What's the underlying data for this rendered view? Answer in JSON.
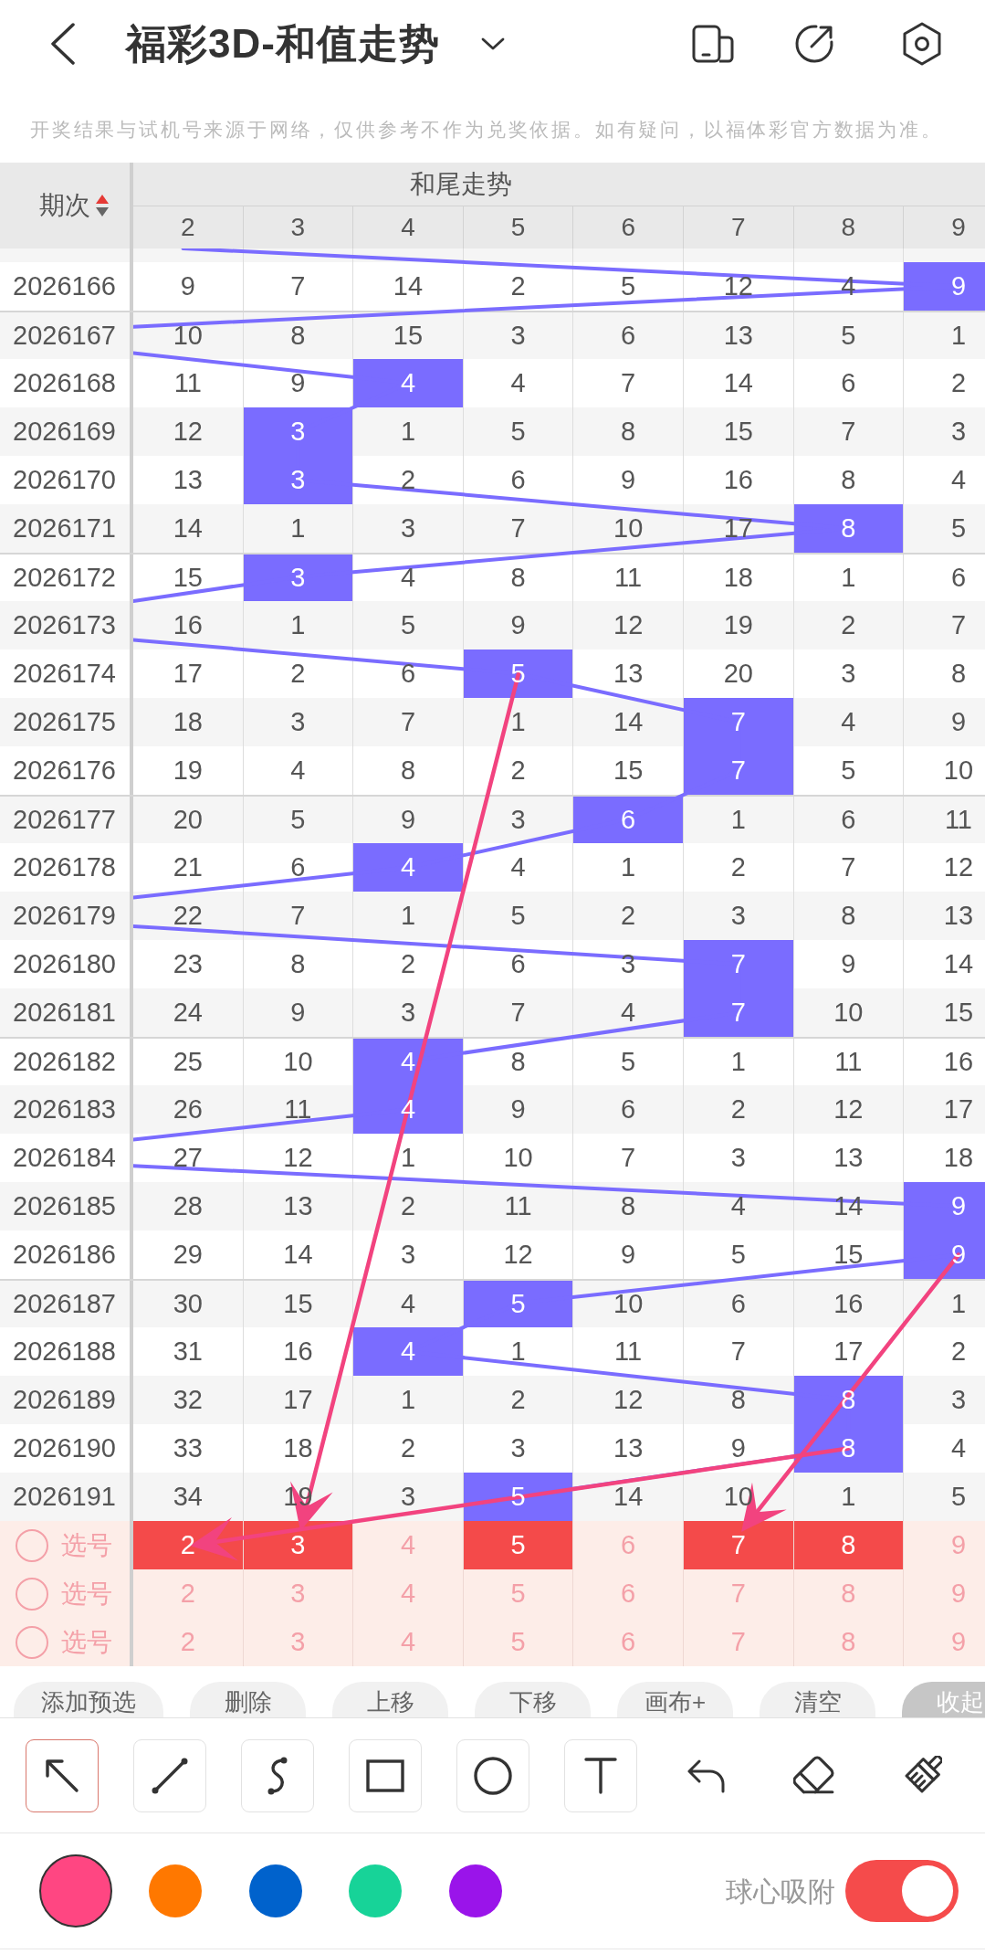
{
  "header": {
    "title": "福彩3D-和值走势"
  },
  "notice": "开奖结果与试机号来源于网络，仅供参考不作为兑奖依据。如有疑问，以福体彩官方数据为准。",
  "table": {
    "issue_column": "期次",
    "sort_ascending": true,
    "group_title": "和尾走势",
    "columns": [
      "2",
      "3",
      "4",
      "5",
      "6",
      "7",
      "8",
      "9"
    ],
    "rows": [
      {
        "issue": "2026166",
        "cells": [
          {
            "value": "9",
            "highlighted": false
          },
          {
            "value": "7",
            "highlighted": false
          },
          {
            "value": "14",
            "highlighted": false
          },
          {
            "value": "2",
            "highlighted": false
          },
          {
            "value": "5",
            "highlighted": false
          },
          {
            "value": "12",
            "highlighted": false
          },
          {
            "value": "4",
            "highlighted": false
          },
          {
            "value": "9",
            "highlighted": true
          }
        ]
      },
      {
        "issue": "2026167",
        "cells": [
          {
            "value": "10",
            "highlighted": false
          },
          {
            "value": "8",
            "highlighted": false
          },
          {
            "value": "15",
            "highlighted": false
          },
          {
            "value": "3",
            "highlighted": false
          },
          {
            "value": "6",
            "highlighted": false
          },
          {
            "value": "13",
            "highlighted": false
          },
          {
            "value": "5",
            "highlighted": false
          },
          {
            "value": "1",
            "highlighted": false
          }
        ]
      },
      {
        "issue": "2026168",
        "cells": [
          {
            "value": "11",
            "highlighted": false
          },
          {
            "value": "9",
            "highlighted": false
          },
          {
            "value": "4",
            "highlighted": true
          },
          {
            "value": "4",
            "highlighted": false
          },
          {
            "value": "7",
            "highlighted": false
          },
          {
            "value": "14",
            "highlighted": false
          },
          {
            "value": "6",
            "highlighted": false
          },
          {
            "value": "2",
            "highlighted": false
          }
        ]
      },
      {
        "issue": "2026169",
        "cells": [
          {
            "value": "12",
            "highlighted": false
          },
          {
            "value": "3",
            "highlighted": true
          },
          {
            "value": "1",
            "highlighted": false
          },
          {
            "value": "5",
            "highlighted": false
          },
          {
            "value": "8",
            "highlighted": false
          },
          {
            "value": "15",
            "highlighted": false
          },
          {
            "value": "7",
            "highlighted": false
          },
          {
            "value": "3",
            "highlighted": false
          }
        ]
      },
      {
        "issue": "2026170",
        "cells": [
          {
            "value": "13",
            "highlighted": false
          },
          {
            "value": "3",
            "highlighted": true
          },
          {
            "value": "2",
            "highlighted": false
          },
          {
            "value": "6",
            "highlighted": false
          },
          {
            "value": "9",
            "highlighted": false
          },
          {
            "value": "16",
            "highlighted": false
          },
          {
            "value": "8",
            "highlighted": false
          },
          {
            "value": "4",
            "highlighted": false
          }
        ]
      },
      {
        "issue": "2026171",
        "cells": [
          {
            "value": "14",
            "highlighted": false
          },
          {
            "value": "1",
            "highlighted": false
          },
          {
            "value": "3",
            "highlighted": false
          },
          {
            "value": "7",
            "highlighted": false
          },
          {
            "value": "10",
            "highlighted": false
          },
          {
            "value": "17",
            "highlighted": false
          },
          {
            "value": "8",
            "highlighted": true
          },
          {
            "value": "5",
            "highlighted": false
          }
        ]
      },
      {
        "issue": "2026172",
        "cells": [
          {
            "value": "15",
            "highlighted": false
          },
          {
            "value": "3",
            "highlighted": true
          },
          {
            "value": "4",
            "highlighted": false
          },
          {
            "value": "8",
            "highlighted": false
          },
          {
            "value": "11",
            "highlighted": false
          },
          {
            "value": "18",
            "highlighted": false
          },
          {
            "value": "1",
            "highlighted": false
          },
          {
            "value": "6",
            "highlighted": false
          }
        ]
      },
      {
        "issue": "2026173",
        "cells": [
          {
            "value": "16",
            "highlighted": false
          },
          {
            "value": "1",
            "highlighted": false
          },
          {
            "value": "5",
            "highlighted": false
          },
          {
            "value": "9",
            "highlighted": false
          },
          {
            "value": "12",
            "highlighted": false
          },
          {
            "value": "19",
            "highlighted": false
          },
          {
            "value": "2",
            "highlighted": false
          },
          {
            "value": "7",
            "highlighted": false
          }
        ]
      },
      {
        "issue": "2026174",
        "cells": [
          {
            "value": "17",
            "highlighted": false
          },
          {
            "value": "2",
            "highlighted": false
          },
          {
            "value": "6",
            "highlighted": false
          },
          {
            "value": "5",
            "highlighted": true
          },
          {
            "value": "13",
            "highlighted": false
          },
          {
            "value": "20",
            "highlighted": false
          },
          {
            "value": "3",
            "highlighted": false
          },
          {
            "value": "8",
            "highlighted": false
          }
        ]
      },
      {
        "issue": "2026175",
        "cells": [
          {
            "value": "18",
            "highlighted": false
          },
          {
            "value": "3",
            "highlighted": false
          },
          {
            "value": "7",
            "highlighted": false
          },
          {
            "value": "1",
            "highlighted": false
          },
          {
            "value": "14",
            "highlighted": false
          },
          {
            "value": "7",
            "highlighted": true
          },
          {
            "value": "4",
            "highlighted": false
          },
          {
            "value": "9",
            "highlighted": false
          }
        ]
      },
      {
        "issue": "2026176",
        "cells": [
          {
            "value": "19",
            "highlighted": false
          },
          {
            "value": "4",
            "highlighted": false
          },
          {
            "value": "8",
            "highlighted": false
          },
          {
            "value": "2",
            "highlighted": false
          },
          {
            "value": "15",
            "highlighted": false
          },
          {
            "value": "7",
            "highlighted": true
          },
          {
            "value": "5",
            "highlighted": false
          },
          {
            "value": "10",
            "highlighted": false
          }
        ]
      },
      {
        "issue": "2026177",
        "cells": [
          {
            "value": "20",
            "highlighted": false
          },
          {
            "value": "5",
            "highlighted": false
          },
          {
            "value": "9",
            "highlighted": false
          },
          {
            "value": "3",
            "highlighted": false
          },
          {
            "value": "6",
            "highlighted": true
          },
          {
            "value": "1",
            "highlighted": false
          },
          {
            "value": "6",
            "highlighted": false
          },
          {
            "value": "11",
            "highlighted": false
          }
        ]
      },
      {
        "issue": "2026178",
        "cells": [
          {
            "value": "21",
            "highlighted": false
          },
          {
            "value": "6",
            "highlighted": false
          },
          {
            "value": "4",
            "highlighted": true
          },
          {
            "value": "4",
            "highlighted": false
          },
          {
            "value": "1",
            "highlighted": false
          },
          {
            "value": "2",
            "highlighted": false
          },
          {
            "value": "7",
            "highlighted": false
          },
          {
            "value": "12",
            "highlighted": false
          }
        ]
      },
      {
        "issue": "2026179",
        "cells": [
          {
            "value": "22",
            "highlighted": false
          },
          {
            "value": "7",
            "highlighted": false
          },
          {
            "value": "1",
            "highlighted": false
          },
          {
            "value": "5",
            "highlighted": false
          },
          {
            "value": "2",
            "highlighted": false
          },
          {
            "value": "3",
            "highlighted": false
          },
          {
            "value": "8",
            "highlighted": false
          },
          {
            "value": "13",
            "highlighted": false
          }
        ]
      },
      {
        "issue": "2026180",
        "cells": [
          {
            "value": "23",
            "highlighted": false
          },
          {
            "value": "8",
            "highlighted": false
          },
          {
            "value": "2",
            "highlighted": false
          },
          {
            "value": "6",
            "highlighted": false
          },
          {
            "value": "3",
            "highlighted": false
          },
          {
            "value": "7",
            "highlighted": true
          },
          {
            "value": "9",
            "highlighted": false
          },
          {
            "value": "14",
            "highlighted": false
          }
        ]
      },
      {
        "issue": "2026181",
        "cells": [
          {
            "value": "24",
            "highlighted": false
          },
          {
            "value": "9",
            "highlighted": false
          },
          {
            "value": "3",
            "highlighted": false
          },
          {
            "value": "7",
            "highlighted": false
          },
          {
            "value": "4",
            "highlighted": false
          },
          {
            "value": "7",
            "highlighted": true
          },
          {
            "value": "10",
            "highlighted": false
          },
          {
            "value": "15",
            "highlighted": false
          }
        ]
      },
      {
        "issue": "2026182",
        "cells": [
          {
            "value": "25",
            "highlighted": false
          },
          {
            "value": "10",
            "highlighted": false
          },
          {
            "value": "4",
            "highlighted": true
          },
          {
            "value": "8",
            "highlighted": false
          },
          {
            "value": "5",
            "highlighted": false
          },
          {
            "value": "1",
            "highlighted": false
          },
          {
            "value": "11",
            "highlighted": false
          },
          {
            "value": "16",
            "highlighted": false
          }
        ]
      },
      {
        "issue": "2026183",
        "cells": [
          {
            "value": "26",
            "highlighted": false
          },
          {
            "value": "11",
            "highlighted": false
          },
          {
            "value": "4",
            "highlighted": true
          },
          {
            "value": "9",
            "highlighted": false
          },
          {
            "value": "6",
            "highlighted": false
          },
          {
            "value": "2",
            "highlighted": false
          },
          {
            "value": "12",
            "highlighted": false
          },
          {
            "value": "17",
            "highlighted": false
          }
        ]
      },
      {
        "issue": "2026184",
        "cells": [
          {
            "value": "27",
            "highlighted": false
          },
          {
            "value": "12",
            "highlighted": false
          },
          {
            "value": "1",
            "highlighted": false
          },
          {
            "value": "10",
            "highlighted": false
          },
          {
            "value": "7",
            "highlighted": false
          },
          {
            "value": "3",
            "highlighted": false
          },
          {
            "value": "13",
            "highlighted": false
          },
          {
            "value": "18",
            "highlighted": false
          }
        ]
      },
      {
        "issue": "2026185",
        "cells": [
          {
            "value": "28",
            "highlighted": false
          },
          {
            "value": "13",
            "highlighted": false
          },
          {
            "value": "2",
            "highlighted": false
          },
          {
            "value": "11",
            "highlighted": false
          },
          {
            "value": "8",
            "highlighted": false
          },
          {
            "value": "4",
            "highlighted": false
          },
          {
            "value": "14",
            "highlighted": false
          },
          {
            "value": "9",
            "highlighted": true
          }
        ]
      },
      {
        "issue": "2026186",
        "cells": [
          {
            "value": "29",
            "highlighted": false
          },
          {
            "value": "14",
            "highlighted": false
          },
          {
            "value": "3",
            "highlighted": false
          },
          {
            "value": "12",
            "highlighted": false
          },
          {
            "value": "9",
            "highlighted": false
          },
          {
            "value": "5",
            "highlighted": false
          },
          {
            "value": "15",
            "highlighted": false
          },
          {
            "value": "9",
            "highlighted": true
          }
        ]
      },
      {
        "issue": "2026187",
        "cells": [
          {
            "value": "30",
            "highlighted": false
          },
          {
            "value": "15",
            "highlighted": false
          },
          {
            "value": "4",
            "highlighted": false
          },
          {
            "value": "5",
            "highlighted": true
          },
          {
            "value": "10",
            "highlighted": false
          },
          {
            "value": "6",
            "highlighted": false
          },
          {
            "value": "16",
            "highlighted": false
          },
          {
            "value": "1",
            "highlighted": false
          }
        ]
      },
      {
        "issue": "2026188",
        "cells": [
          {
            "value": "31",
            "highlighted": false
          },
          {
            "value": "16",
            "highlighted": false
          },
          {
            "value": "4",
            "highlighted": true
          },
          {
            "value": "1",
            "highlighted": false
          },
          {
            "value": "11",
            "highlighted": false
          },
          {
            "value": "7",
            "highlighted": false
          },
          {
            "value": "17",
            "highlighted": false
          },
          {
            "value": "2",
            "highlighted": false
          }
        ]
      },
      {
        "issue": "2026189",
        "cells": [
          {
            "value": "32",
            "highlighted": false
          },
          {
            "value": "17",
            "highlighted": false
          },
          {
            "value": "1",
            "highlighted": false
          },
          {
            "value": "2",
            "highlighted": false
          },
          {
            "value": "12",
            "highlighted": false
          },
          {
            "value": "8",
            "highlighted": false
          },
          {
            "value": "8",
            "highlighted": true
          },
          {
            "value": "3",
            "highlighted": false
          }
        ]
      },
      {
        "issue": "2026190",
        "cells": [
          {
            "value": "33",
            "highlighted": false
          },
          {
            "value": "18",
            "highlighted": false
          },
          {
            "value": "2",
            "highlighted": false
          },
          {
            "value": "3",
            "highlighted": false
          },
          {
            "value": "13",
            "highlighted": false
          },
          {
            "value": "9",
            "highlighted": false
          },
          {
            "value": "8",
            "highlighted": true
          },
          {
            "value": "4",
            "highlighted": false
          }
        ]
      },
      {
        "issue": "2026191",
        "cells": [
          {
            "value": "34",
            "highlighted": false
          },
          {
            "value": "19",
            "highlighted": false
          },
          {
            "value": "3",
            "highlighted": false
          },
          {
            "value": "5",
            "highlighted": true
          },
          {
            "value": "14",
            "highlighted": false
          },
          {
            "value": "10",
            "highlighted": false
          },
          {
            "value": "1",
            "highlighted": false
          },
          {
            "value": "5",
            "highlighted": false
          }
        ]
      }
    ]
  },
  "picks": [
    {
      "label": "选号",
      "checked": false,
      "cells": [
        {
          "value": "2",
          "selected": true
        },
        {
          "value": "3",
          "selected": true
        },
        {
          "value": "4",
          "selected": false
        },
        {
          "value": "5",
          "selected": true
        },
        {
          "value": "6",
          "selected": false
        },
        {
          "value": "7",
          "selected": true
        },
        {
          "value": "8",
          "selected": true
        },
        {
          "value": "9",
          "selected": false
        }
      ]
    },
    {
      "label": "选号",
      "checked": false,
      "cells": [
        {
          "value": "2",
          "selected": false
        },
        {
          "value": "3",
          "selected": false
        },
        {
          "value": "4",
          "selected": false
        },
        {
          "value": "5",
          "selected": false
        },
        {
          "value": "6",
          "selected": false
        },
        {
          "value": "7",
          "selected": false
        },
        {
          "value": "8",
          "selected": false
        },
        {
          "value": "9",
          "selected": false
        }
      ]
    },
    {
      "label": "选号",
      "checked": false,
      "cells": [
        {
          "value": "2",
          "selected": false
        },
        {
          "value": "3",
          "selected": false
        },
        {
          "value": "4",
          "selected": false
        },
        {
          "value": "5",
          "selected": false
        },
        {
          "value": "6",
          "selected": false
        },
        {
          "value": "7",
          "selected": false
        },
        {
          "value": "8",
          "selected": false
        },
        {
          "value": "9",
          "selected": false
        }
      ]
    }
  ],
  "buttons": [
    {
      "label": "添加预选",
      "kind": "action"
    },
    {
      "label": "删除",
      "kind": "action"
    },
    {
      "label": "上移",
      "kind": "action"
    },
    {
      "label": "下移",
      "kind": "action"
    },
    {
      "label": "画布+",
      "kind": "action"
    },
    {
      "label": "清空",
      "kind": "action"
    },
    {
      "label": "收起",
      "kind": "collapse"
    }
  ],
  "tools": [
    {
      "kind": "arrow",
      "selected": true
    },
    {
      "kind": "line",
      "selected": false
    },
    {
      "kind": "curve",
      "selected": false
    },
    {
      "kind": "rectangle",
      "selected": false
    },
    {
      "kind": "circle",
      "selected": false
    },
    {
      "kind": "text",
      "selected": false
    }
  ],
  "colors": [
    {
      "color": "#ff4682",
      "selected": true
    },
    {
      "color": "#ff7800",
      "selected": false
    },
    {
      "color": "#0062cc",
      "selected": false
    },
    {
      "color": "#17d398",
      "selected": false
    },
    {
      "color": "#9a14ea",
      "selected": false
    }
  ],
  "snap": {
    "label": "球心吸附",
    "on": true
  }
}
